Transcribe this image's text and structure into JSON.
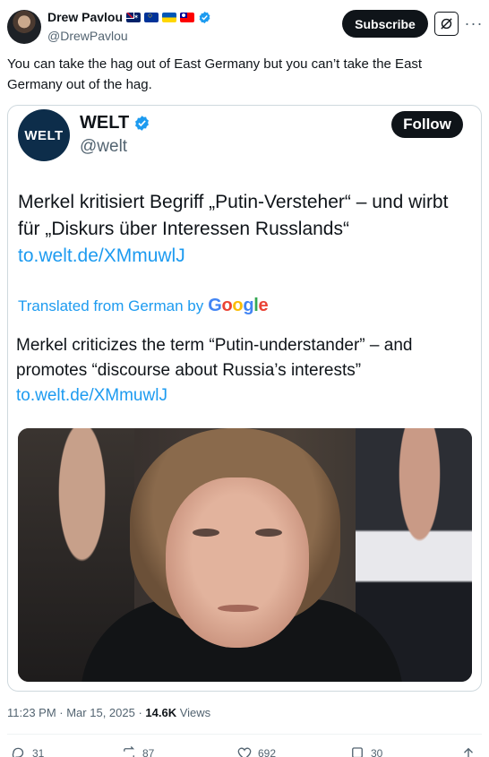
{
  "author": {
    "name": "Drew Pavlou",
    "handle": "@DrewPavlou",
    "flags": [
      "australia-flag",
      "eu-flag",
      "ukraine-flag",
      "taiwan-flag"
    ]
  },
  "header": {
    "subscribe_label": "Subscribe",
    "grok_icon": "grok-icon",
    "more_icon": "more-icon"
  },
  "tweet": {
    "text": "You can take the hag out of East Germany but you can’t take the East Germany out of the hag."
  },
  "quoted": {
    "avatar_text": "WELT",
    "name": "WELT",
    "handle": "@welt",
    "follow_label": "Follow",
    "text": "Merkel kritisiert Begriff „Putin-Versteher“ – und wirbt für „Diskurs über Interessen Russlands“ ",
    "link": "to.welt.de/XMmuwlJ",
    "translated_prefix": "Translated from German by",
    "google_letters": [
      "G",
      "o",
      "o",
      "g",
      "l",
      "e"
    ],
    "translation": "Merkel criticizes the term “Putin-understander” – and promotes “discourse about Russia’s interests”",
    "translation_link": "to.welt.de/XMmuwlJ"
  },
  "meta": {
    "time": "11:23 PM · Mar 15, 2025 · ",
    "views_count": "14.6K",
    "views_label": " Views"
  },
  "actions": {
    "replies": "31",
    "reposts": "87",
    "likes": "692",
    "bookmarks": "30"
  },
  "colors": {
    "accent": "#1d9bf0",
    "text": "#0f1419",
    "muted": "#536471",
    "button": "#0f1419"
  }
}
